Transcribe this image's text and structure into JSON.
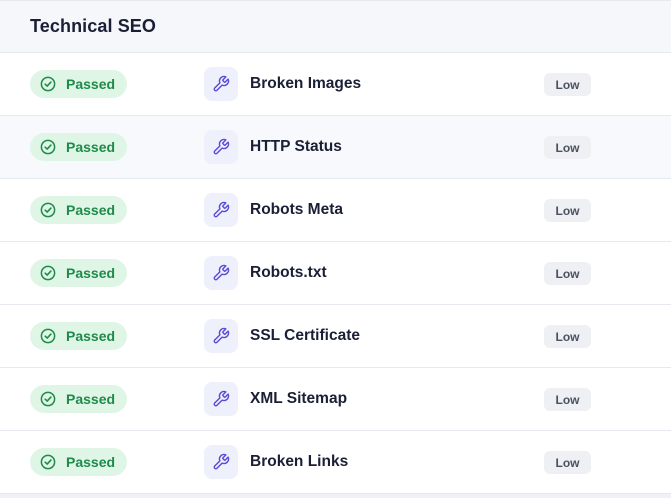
{
  "section": {
    "title": "Technical SEO"
  },
  "colors": {
    "passed_text": "#1f8a4a",
    "passed_bg": "#dff6e6",
    "icon_accent": "#5b4bd6",
    "icon_bg": "#eef1fb",
    "badge_bg": "#eef0f3"
  },
  "icons": {
    "status": "check-circle-icon",
    "tool": "wrench-icon"
  },
  "rows": [
    {
      "status": "Passed",
      "name": "Broken Images",
      "priority": "Low"
    },
    {
      "status": "Passed",
      "name": "HTTP Status",
      "priority": "Low"
    },
    {
      "status": "Passed",
      "name": "Robots Meta",
      "priority": "Low"
    },
    {
      "status": "Passed",
      "name": "Robots.txt",
      "priority": "Low"
    },
    {
      "status": "Passed",
      "name": "SSL Certificate",
      "priority": "Low"
    },
    {
      "status": "Passed",
      "name": "XML Sitemap",
      "priority": "Low"
    },
    {
      "status": "Passed",
      "name": "Broken Links",
      "priority": "Low"
    }
  ]
}
